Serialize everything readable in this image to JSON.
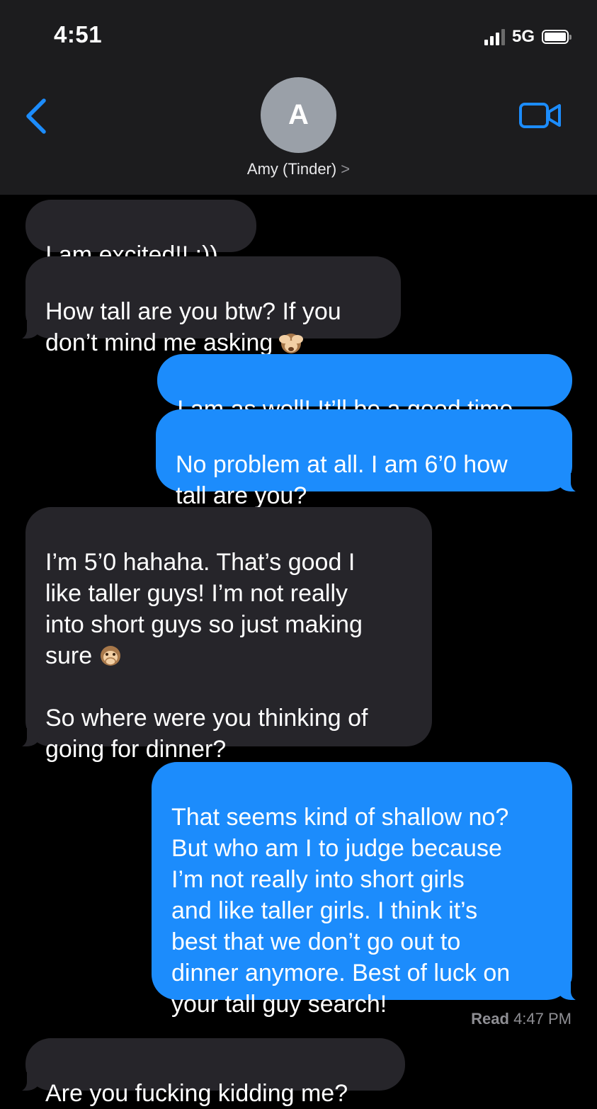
{
  "status_bar": {
    "time": "4:51",
    "network": "5G"
  },
  "header": {
    "avatar_initial": "A",
    "contact_name": "Amy (Tinder)",
    "chevron": ">"
  },
  "messages": [
    {
      "from": "them",
      "text": "I am excited!! :))"
    },
    {
      "from": "them",
      "text": "How tall are you btw? If you\ndon’t mind me asking",
      "emoji": "see-no-evil-monkey"
    },
    {
      "from": "me",
      "text": "I am as well! It’ll be a good time"
    },
    {
      "from": "me",
      "text": "No problem at all. I am 6’0 how\ntall are you?"
    },
    {
      "from": "them",
      "text_a": "I’m 5’0 hahaha. That’s good I\nlike taller guys! I’m not really\ninto short guys so just making\nsure",
      "emoji": "speak-no-evil-monkey",
      "text_b": "So where were you thinking of\ngoing for dinner?"
    },
    {
      "from": "me",
      "text": "That seems kind of shallow no?\nBut who am I to judge because\nI’m not really into short girls\nand like taller girls. I think it’s\nbest that we don’t go out to\ndinner anymore. Best of luck on\nyour tall guy search!"
    },
    {
      "from": "them",
      "text": "Are you fucking kidding me?"
    }
  ],
  "receipt": {
    "label": "Read",
    "time": "4:47 PM"
  },
  "colors": {
    "incoming_bubble": "#26252a",
    "outgoing_bubble": "#1c8cfc",
    "accent": "#1c8cfc",
    "header_bg": "#1c1c1e"
  }
}
